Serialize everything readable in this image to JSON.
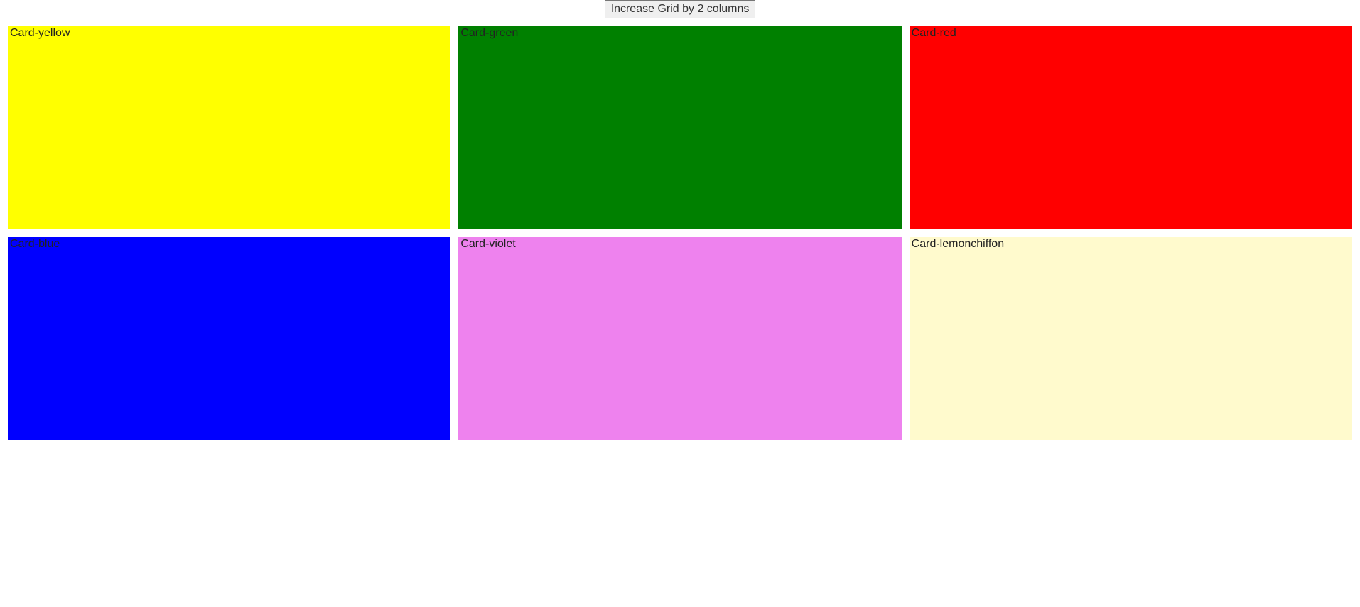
{
  "button": {
    "label": "Increase Grid by 2 columns"
  },
  "cards": [
    {
      "label": "Card-yellow",
      "color": "#ffff00"
    },
    {
      "label": "Card-green",
      "color": "#008000"
    },
    {
      "label": "Card-red",
      "color": "#ff0000"
    },
    {
      "label": "Card-blue",
      "color": "#0000ff"
    },
    {
      "label": "Card-violet",
      "color": "#ee82ee"
    },
    {
      "label": "Card-lemonchiffon",
      "color": "#fffacd"
    }
  ]
}
